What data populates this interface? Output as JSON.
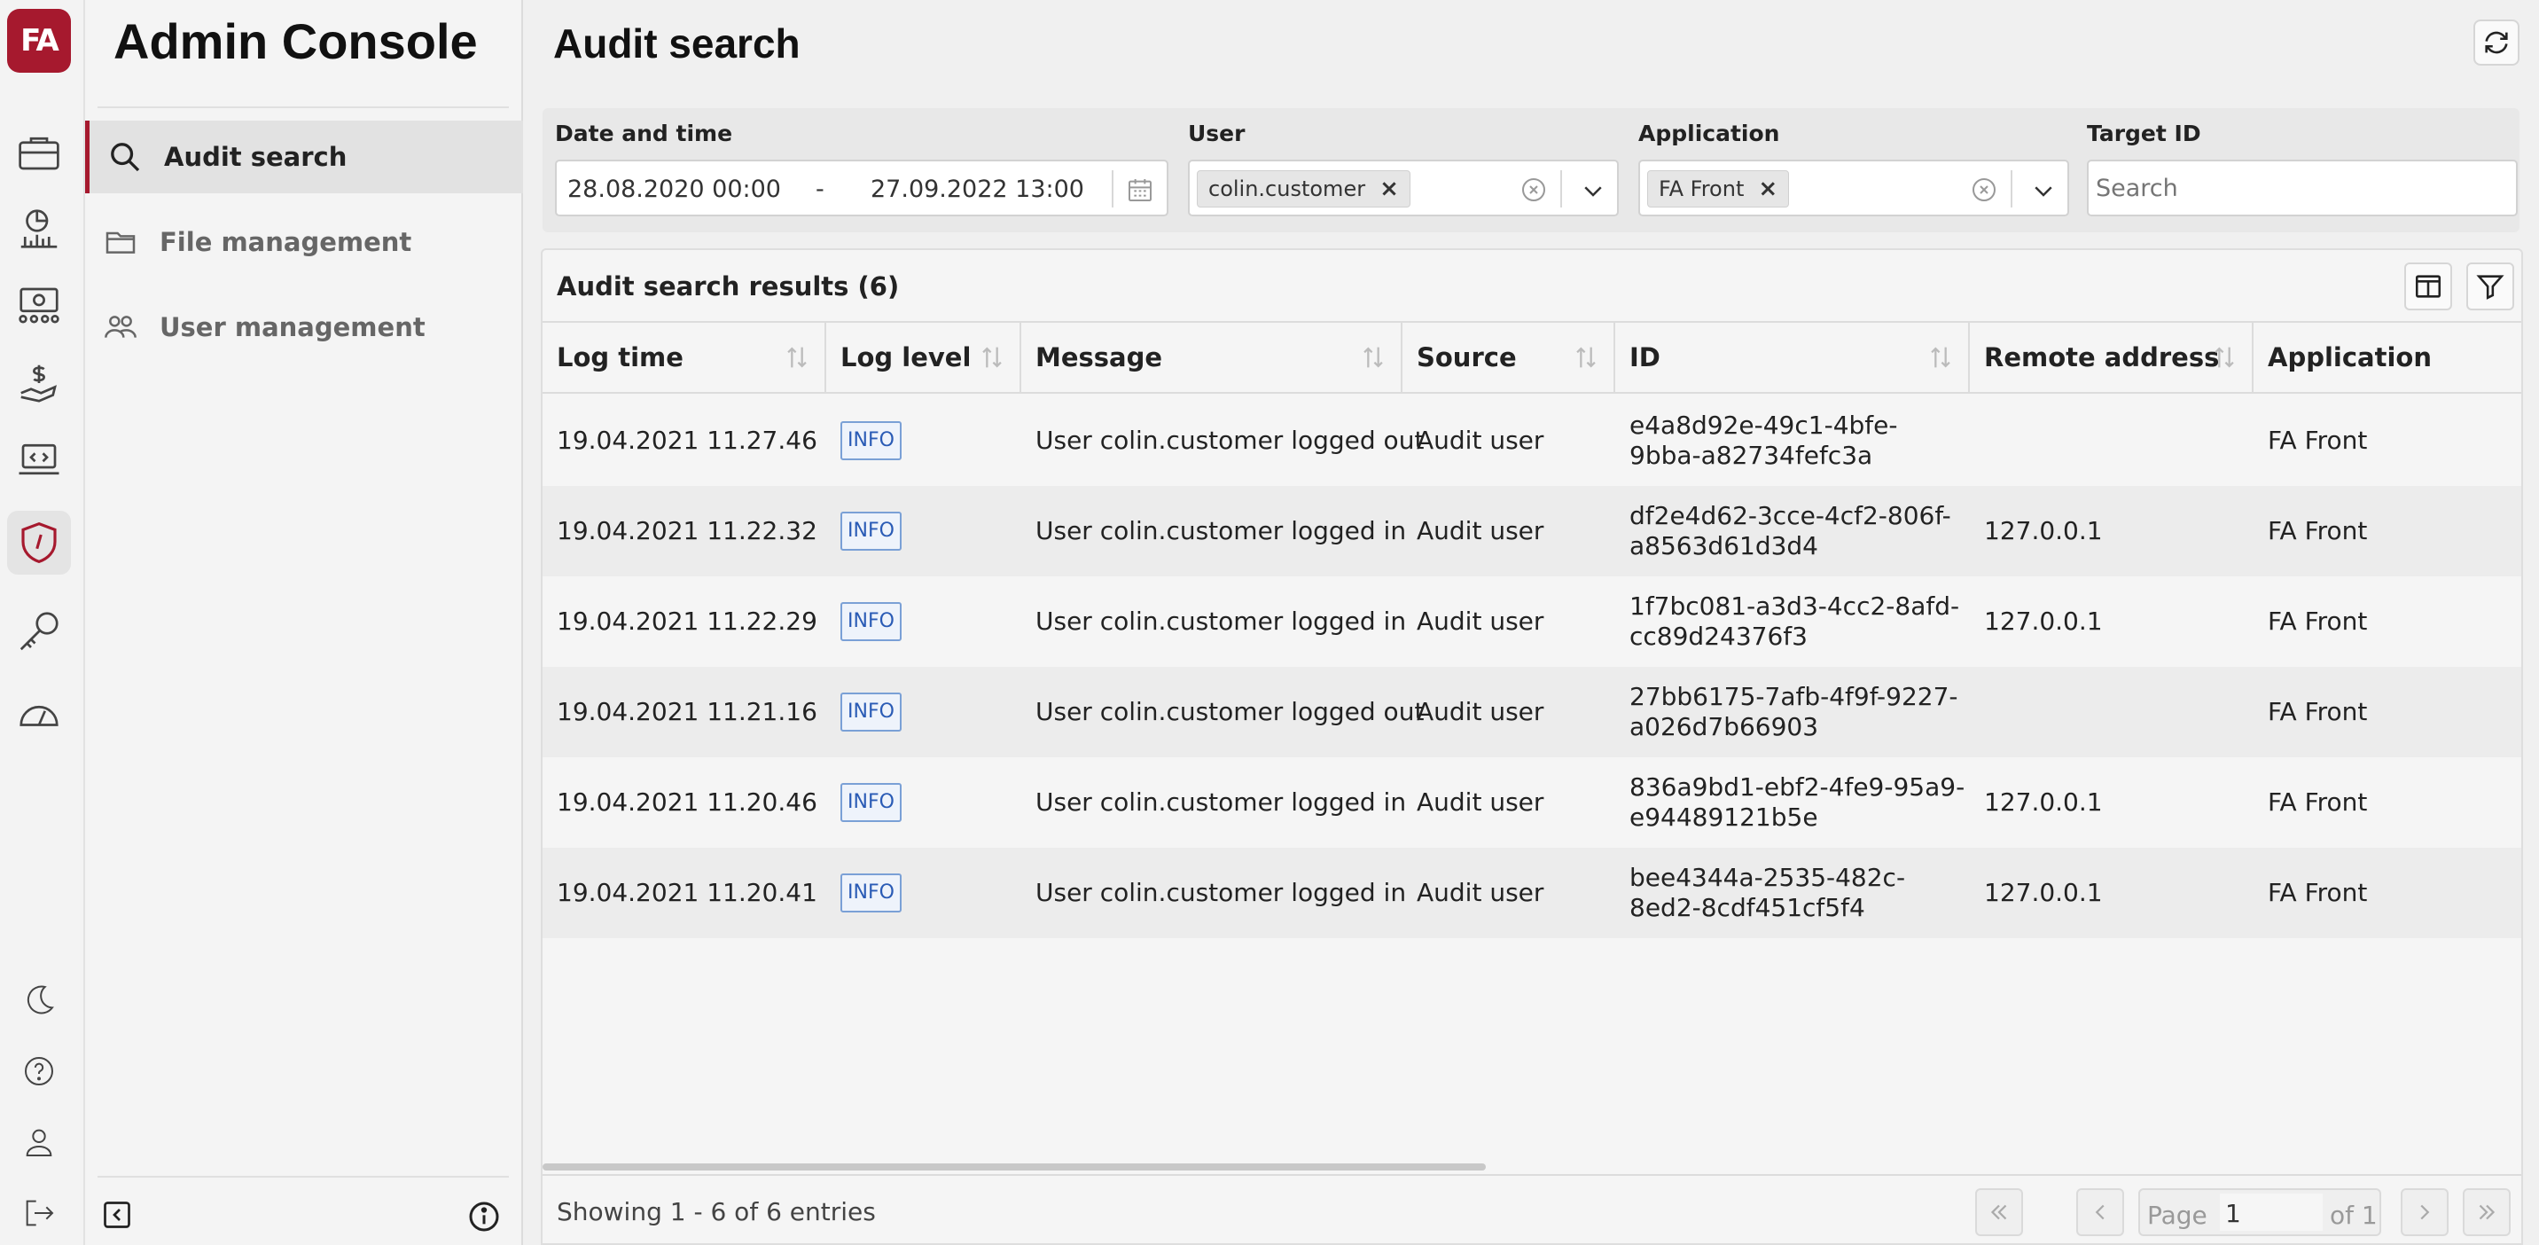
{
  "app": {
    "logo_text": "FA",
    "title": "Admin Console"
  },
  "rail": {
    "items": [
      {
        "icon": "briefcase-icon"
      },
      {
        "icon": "chart-icon"
      },
      {
        "icon": "money-icon"
      },
      {
        "icon": "payment-hand-icon"
      },
      {
        "icon": "laptop-code-icon"
      },
      {
        "icon": "shield-icon",
        "active": true
      },
      {
        "icon": "key-icon"
      },
      {
        "icon": "speedometer-icon"
      }
    ],
    "bottom": [
      {
        "icon": "moon-icon"
      },
      {
        "icon": "help-icon"
      },
      {
        "icon": "user-icon"
      },
      {
        "icon": "logout-icon"
      }
    ]
  },
  "nav": {
    "items": [
      {
        "label": "Audit search",
        "icon": "search-icon",
        "active": true
      },
      {
        "label": "File management",
        "icon": "folder-icon"
      },
      {
        "label": "User management",
        "icon": "users-icon"
      }
    ]
  },
  "page": {
    "title": "Audit search"
  },
  "filters": {
    "date": {
      "label": "Date and time",
      "from": "28.08.2020 00:00",
      "dash": "-",
      "to": "27.09.2022 13:00"
    },
    "user": {
      "label": "User",
      "chip": "colin.customer",
      "chip_x": "×"
    },
    "application": {
      "label": "Application",
      "chip": "FA Front",
      "chip_x": "×"
    },
    "target": {
      "label": "Target ID",
      "placeholder": "Search"
    }
  },
  "results": {
    "title": "Audit search results (6)",
    "columns": [
      "Log time",
      "Log level",
      "Message",
      "Source",
      "ID",
      "Remote address",
      "Application"
    ],
    "rows": [
      {
        "time": "19.04.2021 11.27.46",
        "level": "INFO",
        "message": "User colin.customer logged out",
        "source": "Audit user",
        "id1": "e4a8d92e-49c1-4bfe-",
        "id2": "9bba-a82734fefc3a",
        "remote": "",
        "app": "FA Front"
      },
      {
        "time": "19.04.2021 11.22.32",
        "level": "INFO",
        "message": "User colin.customer logged in",
        "source": "Audit user",
        "id1": "df2e4d62-3cce-4cf2-806f-",
        "id2": "a8563d61d3d4",
        "remote": "127.0.0.1",
        "app": "FA Front"
      },
      {
        "time": "19.04.2021 11.22.29",
        "level": "INFO",
        "message": "User colin.customer logged in",
        "source": "Audit user",
        "id1": "1f7bc081-a3d3-4cc2-8afd-",
        "id2": "cc89d24376f3",
        "remote": "127.0.0.1",
        "app": "FA Front"
      },
      {
        "time": "19.04.2021 11.21.16",
        "level": "INFO",
        "message": "User colin.customer logged out",
        "source": "Audit user",
        "id1": "27bb6175-7afb-4f9f-9227-",
        "id2": "a026d7b66903",
        "remote": "",
        "app": "FA Front"
      },
      {
        "time": "19.04.2021 11.20.46",
        "level": "INFO",
        "message": "User colin.customer logged in",
        "source": "Audit user",
        "id1": "836a9bd1-ebf2-4fe9-95a9-",
        "id2": "e94489121b5e",
        "remote": "127.0.0.1",
        "app": "FA Front"
      },
      {
        "time": "19.04.2021 11.20.41",
        "level": "INFO",
        "message": "User colin.customer logged in",
        "source": "Audit user",
        "id1": "bee4344a-2535-482c-",
        "id2": "8ed2-8cdf451cf5f4",
        "remote": "127.0.0.1",
        "app": "FA Front"
      }
    ],
    "footer": "Showing 1 - 6 of 6 entries"
  },
  "pagination": {
    "page_label": "Page",
    "page_value": "1",
    "of_label": "of 1"
  },
  "colors": {
    "brand": "#a6192e",
    "info_badge": "#2a5bb5"
  }
}
